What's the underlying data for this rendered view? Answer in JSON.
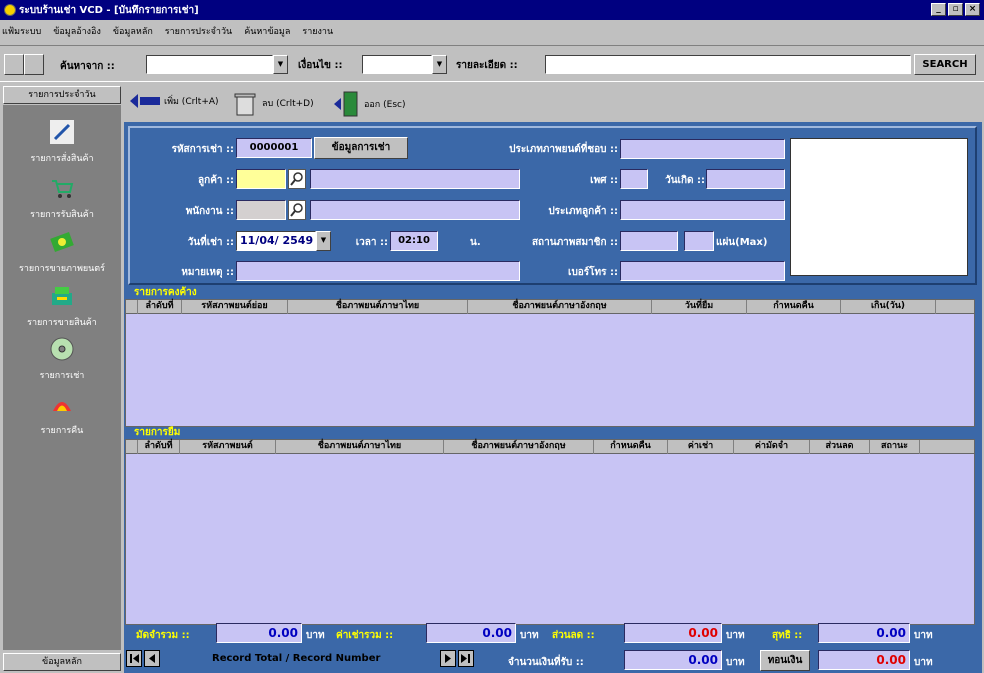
{
  "window": {
    "title": "ระบบร้านเช่า VCD - [บันทึกรายการเช่า]",
    "controls": [
      "_",
      "▫",
      "×"
    ]
  },
  "menu": [
    "แฟ้มระบบ",
    "ข้อมูลอ้างอิง",
    "ข้อมูลหลัก",
    "รายการประจำวัน",
    "ค้นหาข้อมูล",
    "รายงาน"
  ],
  "search": {
    "from_label": "ค้นหาจาก ::",
    "condition_label": "เงื่อนไข ::",
    "detail_label": "รายละเอียด ::",
    "button": "SEARCH"
  },
  "sidebar": {
    "header": "รายการประจำวัน",
    "items": [
      {
        "label": "รายการสั่งสินค้า",
        "icon": "pen-icon"
      },
      {
        "label": "รายการรับสินค้า",
        "icon": "cart-icon"
      },
      {
        "label": "รายการขายภาพยนตร์",
        "icon": "money-icon"
      },
      {
        "label": "รายการขายสินค้า",
        "icon": "cash-register-icon"
      },
      {
        "label": "รายการเช่า",
        "icon": "cd-icon"
      },
      {
        "label": "รายการคืน",
        "icon": "return-icon"
      }
    ],
    "footer": "ข้อมูลหลัก"
  },
  "toolbar": {
    "add": "เพิ่ม (Crlt+A)",
    "delete": "ลบ (Crlt+D)",
    "exit": "ออก (Esc)"
  },
  "form": {
    "rent_id_label": "รหัสการเช่า ::",
    "rent_id_value": "0000001",
    "rent_info_button": "ข้อมูลการเช่า",
    "movie_type_label": "ประเภทภาพยนต์ที่ชอบ ::",
    "customer_label": "ลูกค้า ::",
    "sex_label": "เพศ ::",
    "birthday_label": "วันเกิด ::",
    "employee_label": "พนักงาน ::",
    "customer_type_label": "ประเภทลูกค้า ::",
    "date_label": "วันที่เช่า ::",
    "date_value": "11/04/ 2549",
    "time_label": "เวลา ::",
    "time_value": "02:10",
    "time_unit": "น.",
    "member_status_label": "สถานภาพสมาชิก ::",
    "max_label": "แผ่น(Max)",
    "note_label": "หมายเหตุ ::",
    "phone_label": "เบอร์โทร ::"
  },
  "outstanding": {
    "title": "รายการคงค้าง",
    "columns": [
      "ลำดับที่",
      "รหัสภาพยนต์ย่อย",
      "ชื่อภาพยนต์ภาษาไทย",
      "ชื่อภาพยนต์ภาษาอังกฤษ",
      "วันที่ยืม",
      "กำหนดคืน",
      "เกิน(วัน)"
    ],
    "rows": []
  },
  "borrow": {
    "title": "รายการยืม",
    "columns": [
      "ลำดับที่",
      "รหัสภาพยนต์",
      "ชื่อภาพยนต์ภาษาไทย",
      "ชื่อภาพยนต์ภาษาอังกฤษ",
      "กำหนดคืน",
      "ค่าเช่า",
      "ค่ามัดจำ",
      "ส่วนลด",
      "สถานะ"
    ],
    "rows": []
  },
  "totals": {
    "deposit_label": "มัดจำรวม ::",
    "deposit_value": "0.00",
    "rent_label": "ค่าเช่ารวม ::",
    "rent_value": "0.00",
    "discount_label": "ส่วนลด ::",
    "discount_value": "0.00",
    "net_label": "สุทธิ ::",
    "net_value": "0.00",
    "received_label": "จำนวนเงินที่รับ ::",
    "received_value": "0.00",
    "change_button": "ทอนเงิน",
    "change_value": "0.00",
    "unit": "บาท",
    "record_label": "Record Total / Record Number"
  }
}
